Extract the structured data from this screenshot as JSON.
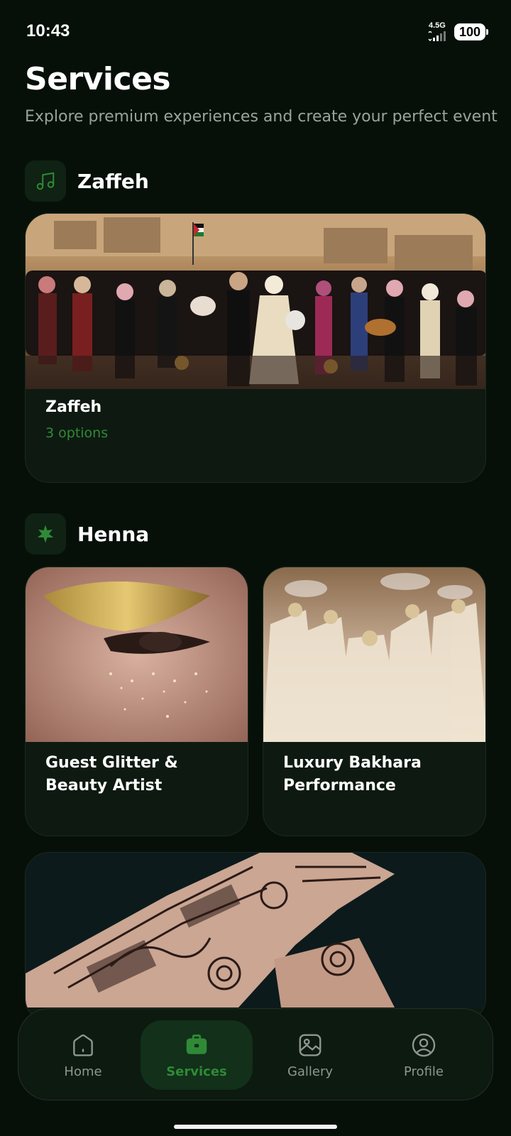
{
  "status": {
    "time": "10:43",
    "network": "4.5G",
    "battery": "100"
  },
  "header": {
    "title": "Services",
    "subtitle": "Explore premium experiences and create your perfect event"
  },
  "sections": [
    {
      "title": "Zaffeh",
      "icon": "music-note-icon",
      "cards": [
        {
          "title": "Zaffeh",
          "subtitle": "3 options"
        }
      ]
    },
    {
      "title": "Henna",
      "icon": "henna-leaf-icon",
      "cards": [
        {
          "title": "Guest Glitter & Beauty Artist"
        },
        {
          "title": "Luxury Bakhara Performance"
        },
        {
          "title": ""
        }
      ]
    }
  ],
  "nav": {
    "items": [
      {
        "label": "Home",
        "icon": "home-icon"
      },
      {
        "label": "Services",
        "icon": "briefcase-icon",
        "active": true
      },
      {
        "label": "Gallery",
        "icon": "image-icon"
      },
      {
        "label": "Profile",
        "icon": "user-circle-icon"
      }
    ]
  },
  "colors": {
    "background": "#061009",
    "accent": "#2f8a36",
    "card": "#0e1a11"
  }
}
